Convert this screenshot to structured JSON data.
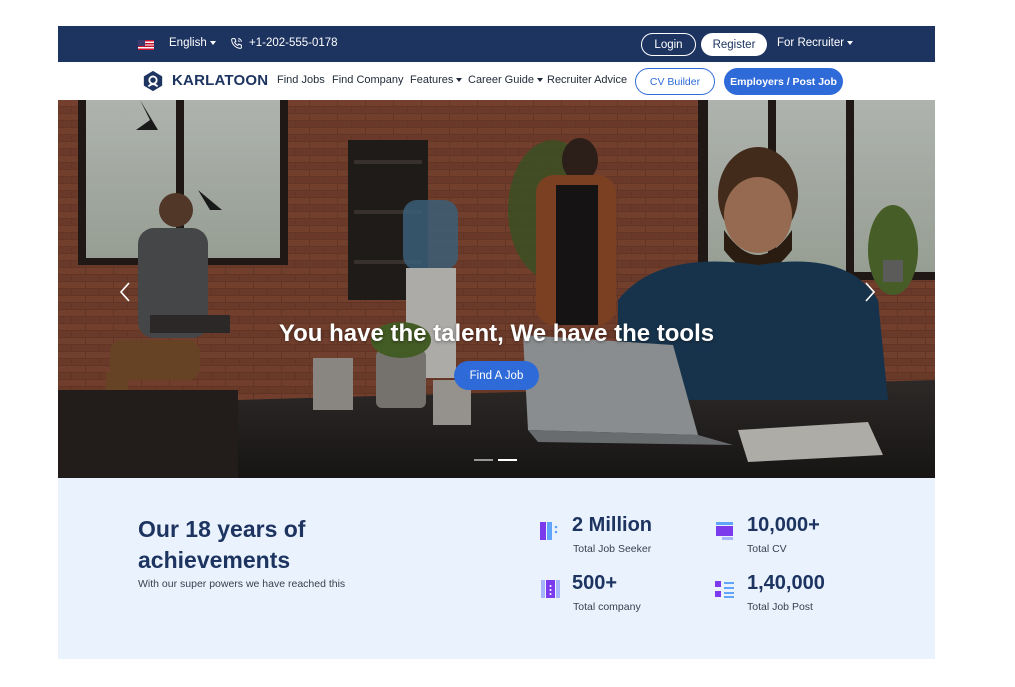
{
  "topbar": {
    "language": "English",
    "phone": "+1-202-555-0178",
    "login_label": "Login",
    "register_label": "Register",
    "recruiter_label": "For Recruiter"
  },
  "navbar": {
    "logo_text": "KARLATOON",
    "items": [
      "Find Jobs",
      "Find Company",
      "Features",
      "Career Guide",
      "Recruiter Advice"
    ],
    "cv_builder_label": "CV Builder",
    "post_job_label": "Employers / Post Job"
  },
  "hero": {
    "title": "You have the talent, We have the tools",
    "cta_label": "Find A Job",
    "slides_total": 2,
    "active_slide": 2
  },
  "achievements": {
    "title": "Our 18 years of achievements",
    "subtitle": "With our super powers we have reached this",
    "stats": [
      {
        "value": "2 Million",
        "label": "Total Job Seeker",
        "icon": "job-seeker-icon"
      },
      {
        "value": "10,000+",
        "label": "Total CV",
        "icon": "cv-icon"
      },
      {
        "value": "500+",
        "label": "Total company",
        "icon": "company-icon"
      },
      {
        "value": "1,40,000",
        "label": "Total Job Post",
        "icon": "job-post-icon"
      }
    ]
  },
  "colors": {
    "navy": "#1d3461",
    "accent_blue": "#2f6bd8",
    "stats_bg": "#eaf3fd",
    "icon_purple": "#7c3aed"
  }
}
